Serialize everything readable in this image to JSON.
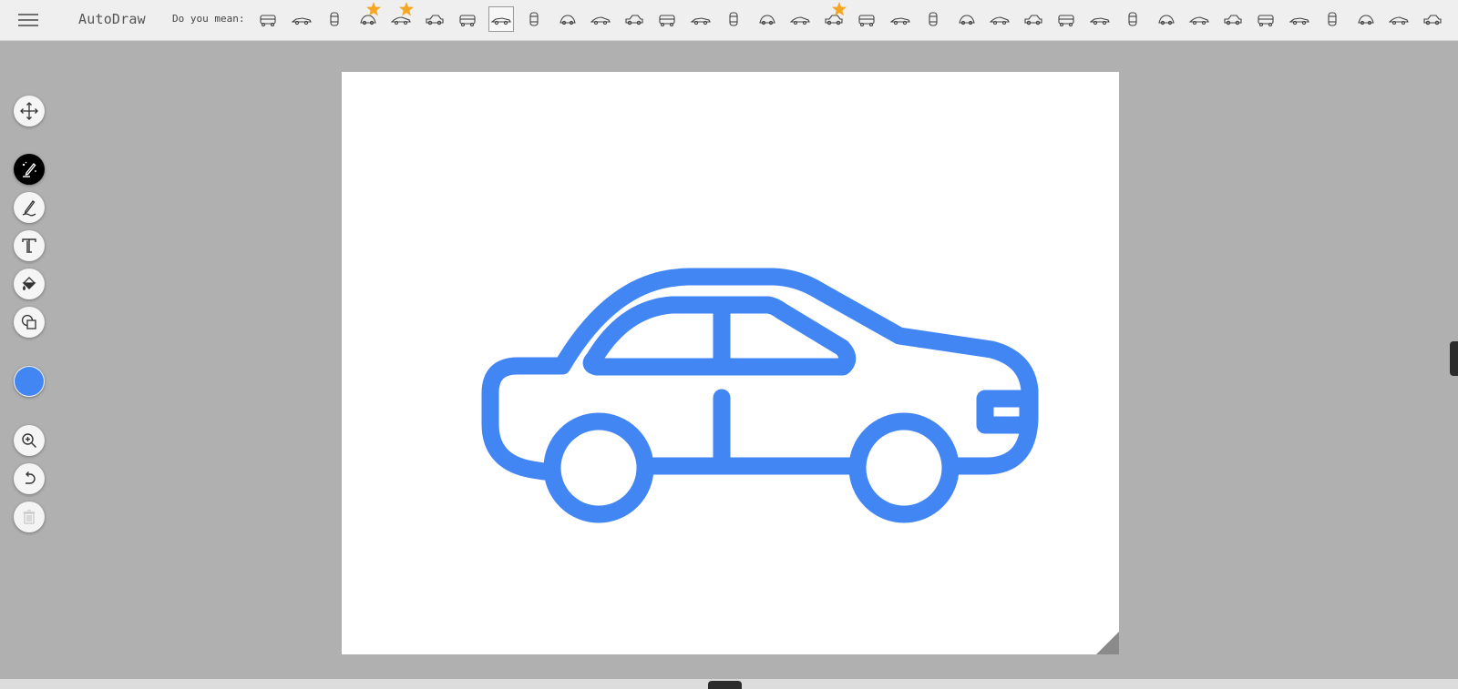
{
  "app": {
    "title": "AutoDraw"
  },
  "header": {
    "menu_icon": "hamburger-icon",
    "suggest_label": "Do you mean:",
    "suggestions": [
      {
        "icon": "car-front-icon"
      },
      {
        "icon": "race-car-icon"
      },
      {
        "icon": "car-top-icon"
      },
      {
        "icon": "beetle-car-icon",
        "starred": true
      },
      {
        "icon": "sports-car-icon",
        "starred": true
      },
      {
        "icon": "sedan-icon"
      },
      {
        "icon": "car-icon"
      },
      {
        "icon": "sedan-outline-icon",
        "selected": true
      },
      {
        "icon": "van-icon"
      },
      {
        "icon": "bus-front-icon"
      },
      {
        "icon": "minivan-icon"
      },
      {
        "icon": "ufo-icon"
      },
      {
        "icon": "turtle-icon"
      },
      {
        "icon": "fish-icon"
      },
      {
        "icon": "insect-icon"
      },
      {
        "icon": "snail-icon"
      },
      {
        "icon": "lobster-icon"
      },
      {
        "icon": "bus-icon",
        "starred": true
      },
      {
        "icon": "bus-outline-icon"
      },
      {
        "icon": "coach-icon"
      },
      {
        "icon": "trolley-icon"
      },
      {
        "icon": "bus-dark-icon"
      },
      {
        "icon": "truck-front-icon"
      },
      {
        "icon": "van-dark-icon"
      },
      {
        "icon": "tram-icon"
      },
      {
        "icon": "rail-car-icon"
      },
      {
        "icon": "fire-truck-icon"
      },
      {
        "icon": "limousine-icon"
      },
      {
        "icon": "tow-truck-icon"
      },
      {
        "icon": "semi-truck-icon"
      },
      {
        "icon": "coupe-icon"
      },
      {
        "icon": "jeep-icon"
      },
      {
        "icon": "roadster-icon"
      },
      {
        "icon": "mountain-icon"
      },
      {
        "icon": "lighthouse-icon"
      },
      {
        "icon": "eiffel-tower-icon"
      }
    ]
  },
  "tools": [
    {
      "name": "move-tool",
      "icon": "move-icon"
    },
    {
      "name": "autodraw-tool",
      "icon": "autodraw-icon",
      "active": true
    },
    {
      "name": "draw-tool",
      "icon": "pencil-icon"
    },
    {
      "name": "type-tool",
      "icon": "text-icon"
    },
    {
      "name": "fill-tool",
      "icon": "paint-bucket-icon"
    },
    {
      "name": "shape-tool",
      "icon": "shapes-icon"
    },
    {
      "name": "color-picker",
      "icon": "color-swatch"
    },
    {
      "name": "zoom-tool",
      "icon": "zoom-in-icon"
    },
    {
      "name": "undo-button",
      "icon": "undo-icon"
    },
    {
      "name": "delete-button",
      "icon": "trash-icon",
      "disabled": true
    }
  ],
  "colors": {
    "drawing": "#4286f4",
    "swatch": "#4286f4",
    "star": "#f5a623",
    "canvas_bg": "#ffffff",
    "workspace_bg": "#b0b0b0"
  },
  "canvas": {
    "drawing": "sedan-car-drawing"
  }
}
